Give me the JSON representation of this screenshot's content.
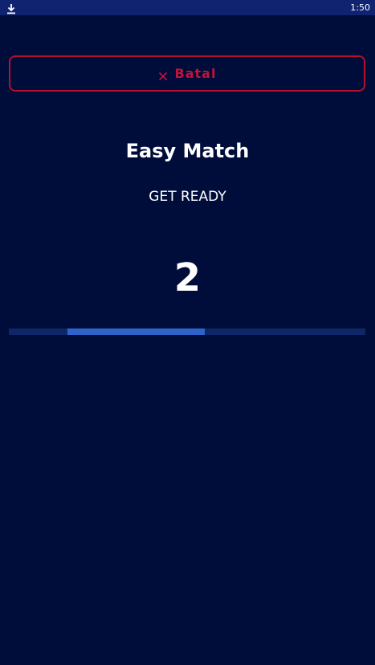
{
  "status_bar": {
    "time": "1:50",
    "left_icon": "download-icon"
  },
  "cancel": {
    "label": "Batal",
    "icon": "close-icon",
    "color": "#b3102e"
  },
  "game": {
    "title": "Easy Match",
    "status": "GET READY",
    "countdown": "2"
  },
  "progress": {
    "start_fraction": 0.165,
    "end_fraction": 0.55,
    "fill_color": "#2f63c9",
    "track_color": "#0e2766"
  },
  "colors": {
    "background": "#000d3a",
    "status_bar": "#0f2370",
    "accent": "#b3102e"
  }
}
